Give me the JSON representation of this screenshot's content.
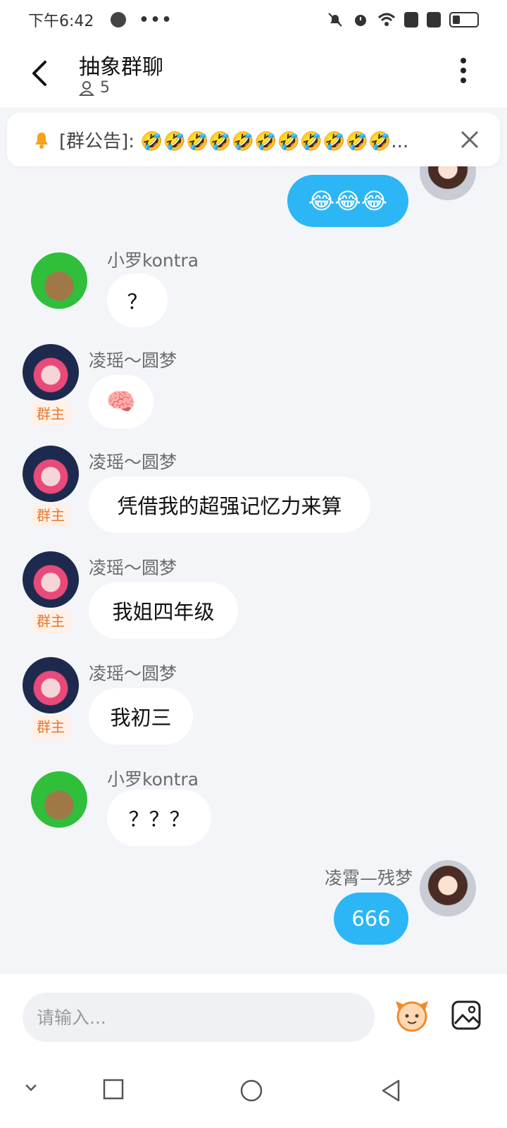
{
  "status_bar": {
    "time": "下午6:42",
    "dots": "•••"
  },
  "header": {
    "title": "抽象群聊",
    "member_count": "5"
  },
  "announcement": {
    "text": "[群公告]: 🤣🤣🤣🤣🤣🤣🤣🤣🤣🤣🤣..."
  },
  "messages": [
    {
      "sender": "",
      "text": "😂😂😂",
      "mine": true
    },
    {
      "sender": "小罗kontra",
      "text": "？",
      "mine": false
    },
    {
      "sender": "凌瑶～圆梦",
      "badge": "群主",
      "text": "🧠",
      "mine": false
    },
    {
      "sender": "凌瑶～圆梦",
      "badge": "群主",
      "text": "凭借我的超强记忆力来算",
      "mine": false
    },
    {
      "sender": "凌瑶～圆梦",
      "badge": "群主",
      "text": "我姐四年级",
      "mine": false
    },
    {
      "sender": "凌瑶～圆梦",
      "badge": "群主",
      "text": "我初三",
      "mine": false
    },
    {
      "sender": "小罗kontra",
      "text": "？？？",
      "mine": false
    },
    {
      "sender": "凌霄—残梦",
      "text": "666",
      "mine": true
    }
  ],
  "input": {
    "placeholder": "请输入..."
  },
  "colors": {
    "mine_bubble": "#2cb6f5",
    "background": "#f3f5f9",
    "owner_badge": "#e8772e"
  },
  "icons": [
    "back-icon",
    "more-icon",
    "bell-icon",
    "close-icon",
    "sticker-icon",
    "image-icon",
    "nav-back-icon",
    "nav-home-icon",
    "nav-recent-icon"
  ]
}
